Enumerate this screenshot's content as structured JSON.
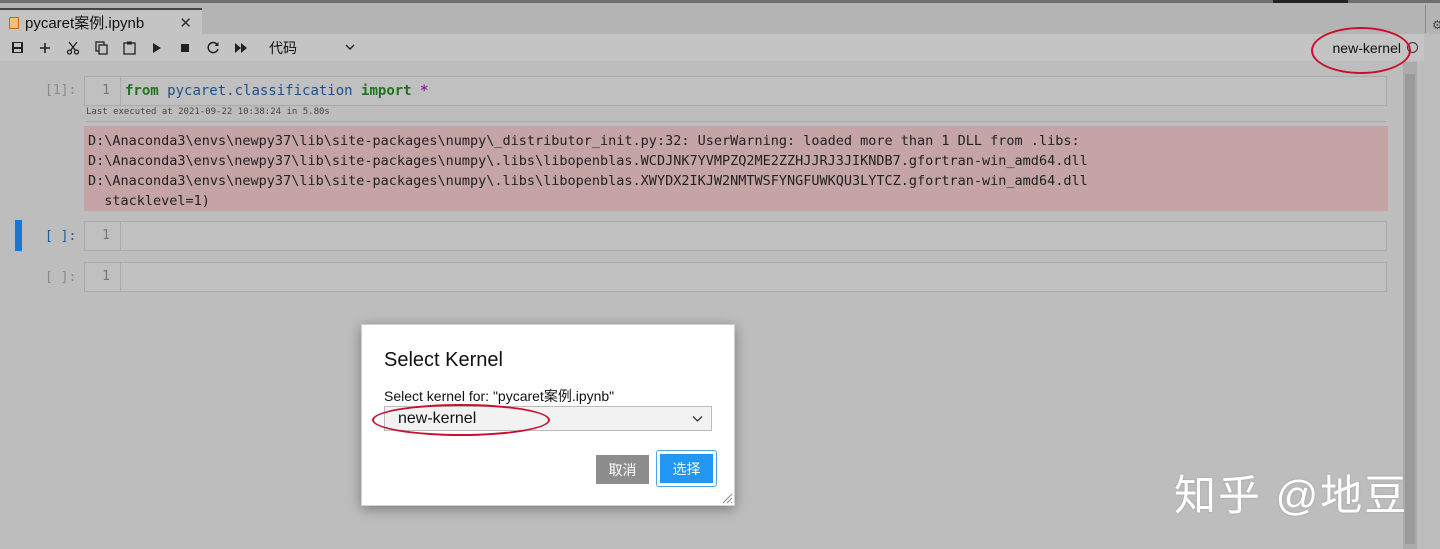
{
  "tab": {
    "title": "pycaret案例.ipynb",
    "close_glyph": "✕"
  },
  "toolbar": {
    "icons": [
      "save-icon",
      "add-icon",
      "cut-icon",
      "copy-icon",
      "paste-icon",
      "run-icon",
      "stop-icon",
      "restart-icon",
      "run-all-icon"
    ],
    "cell_type": "代码",
    "kernel_name": "new-kernel"
  },
  "cells": [
    {
      "prompt": "[1]:",
      "line_no": "1",
      "code": {
        "kw1": "from",
        "module": "pycaret.classification",
        "kw2": "import",
        "star": "*"
      }
    },
    {
      "prompt": "[ ]:",
      "line_no": "1"
    },
    {
      "prompt": "[ ]:",
      "line_no": "1"
    }
  ],
  "exec_info": "Last executed at 2021-09-22 10:38:24 in 5.80s",
  "output_lines": [
    "D:\\Anaconda3\\envs\\newpy37\\lib\\site-packages\\numpy\\_distributor_init.py:32: UserWarning: loaded more than 1 DLL from .libs:",
    "D:\\Anaconda3\\envs\\newpy37\\lib\\site-packages\\numpy\\.libs\\libopenblas.WCDJNK7YVMPZQ2ME2ZZHJJRJ3JIKNDB7.gfortran-win_amd64.dll",
    "D:\\Anaconda3\\envs\\newpy37\\lib\\site-packages\\numpy\\.libs\\libopenblas.XWYDX2IKJW2NMTWSFYNGFUWKQU3LYTCZ.gfortran-win_amd64.dll",
    "  stacklevel=1)"
  ],
  "dialog": {
    "title": "Select Kernel",
    "label": "Select kernel for: \"pycaret案例.ipynb\"",
    "selected": "new-kernel",
    "cancel": "取消",
    "ok": "选择"
  },
  "watermark": "知乎 @地豆",
  "colors": {
    "annotation": "#c8102e",
    "primary": "#2196f3",
    "active_cell": "#1976d2",
    "output_bg": "#c4a4a4"
  }
}
